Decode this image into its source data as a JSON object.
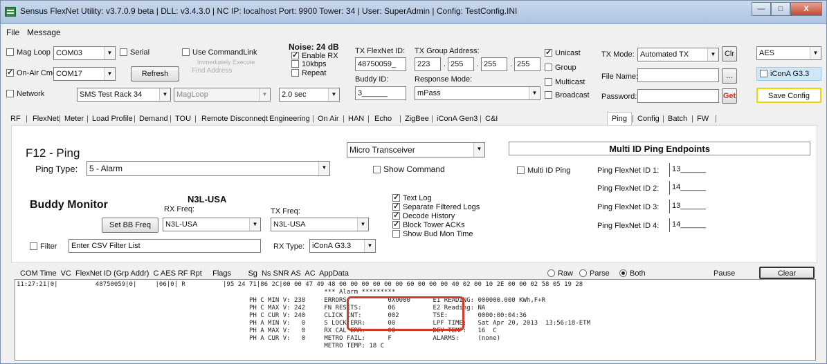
{
  "window": {
    "title": "Sensus FlexNet Utility: v3.7.0.9 beta | DLL: v3.4.3.0 | NC IP: localhost  Port: 9900  Tower: 34 | User: SuperAdmin | Config: TestConfig.INI",
    "min": "—",
    "max": "□",
    "close": "X"
  },
  "menu": {
    "file": "File",
    "message": "Message"
  },
  "conn": {
    "mag_loop_label": "Mag Loop",
    "mag_loop_port": "COM03",
    "serial_label": "Serial",
    "use_commandlink_label": "Use CommandLink",
    "immediately_execute": "Immediately Execute",
    "find_address": "Find Address",
    "onair_label": "On-Air Cmd",
    "onair_port": "COM17",
    "refresh_button": "Refresh",
    "network_label": "Network",
    "network_value": "SMS Test Rack 34",
    "magloop_combo": "MagLoop"
  },
  "noise": {
    "title": "Noise: 24 dB",
    "enable_rx": "Enable RX",
    "kbps": "10kbps",
    "repeat": "Repeat",
    "interval": "2.0 sec"
  },
  "tx": {
    "flexnet_id_label": "TX FlexNet ID:",
    "flexnet_id": "48750059_",
    "group_addr_label": "TX Group Address:",
    "group_1": "223",
    "group_2": "255",
    "group_3": "255",
    "group_4": "255",
    "buddy_id_label": "Buddy ID:",
    "buddy_id": "3______",
    "response_mode_label": "Response Mode:",
    "response_mode": "mPass",
    "unicast": "Unicast",
    "group": "Group",
    "multicast": "Multicast",
    "broadcast": "Broadcast",
    "mode_label": "TX Mode:",
    "mode_value": "Automated TX",
    "clr_button": "Clr",
    "file_name_label": "File Name:",
    "browse_button": "...",
    "password_label": "Password:",
    "get_button": "Get",
    "encryption": "AES",
    "icona_checkbox": "iConA G3.3",
    "save_config_button": "Save Config"
  },
  "tabs": [
    "RF",
    "FlexNet",
    "Meter",
    "Load Profile",
    "Demand",
    "TOU",
    "Remote Disconnect",
    "Engineering",
    "On Air",
    "HAN",
    "Echo",
    "ZigBee",
    "iConA Gen3",
    "C&I",
    "Ping",
    "Config",
    "Batch",
    "FW"
  ],
  "ping": {
    "title": "F12 - Ping",
    "type_label": "Ping Type:",
    "type_value": "5 - Alarm",
    "transceiver": "Micro Transceiver",
    "show_command": "Show Command",
    "multi_title": "Multi ID Ping Endpoints",
    "multi_id_ping": "Multi ID Ping",
    "id1_label": "Ping FlexNet ID 1:",
    "id1": "13______",
    "id2_label": "Ping FlexNet ID 2:",
    "id2": "14______",
    "id3_label": "Ping FlexNet ID 3:",
    "id3": "13______",
    "id4_label": "Ping FlexNet ID 4:",
    "id4": "14______"
  },
  "buddy": {
    "title": "Buddy Monitor",
    "region": "N3L-USA",
    "rx_freq_label": "RX Freq:",
    "rx_freq": "N3L-USA",
    "tx_freq_label": "TX Freq:",
    "tx_freq": "N3L-USA",
    "set_bb_freq": "Set BB Freq",
    "filter_label": "Filter",
    "filter_placeholder": "Enter CSV Filter List",
    "rx_type_label": "RX Type:",
    "rx_type": "iConA G3.3",
    "text_log": "Text Log",
    "separate_logs": "Separate Filtered Logs",
    "decode_history": "Decode History",
    "block_acks": "Block Tower ACKs",
    "show_bud_time": "Show Bud Mon Time"
  },
  "log": {
    "header": "COM Time  VC  FlexNet ID (Grp Addr)  C AES RF Rpt     Flags        Sg  Ns SNR AS  AC  AppData",
    "raw": "Raw",
    "parse": "Parse",
    "both": "Both",
    "pause": "Pause",
    "clear_button": "Clear",
    "lines": [
      "11:27:21|0|          48750059|0|     |06|0| R          |95 24 71|86 2C|00 00 47 49 48 00 00 00 00 00 00 60 00 00 00 40 02 00 10 2E 00 00 02 58 05 19 28",
      "                                                                                  *** Alarm *********",
      "                                                              PH C MIN V: 238     ERRORS:          0X0000      E1 READING: 000000.000 KWh,F+R",
      "                                                              PH C MAX V: 242     FN RESETS:       06          E2 Reading: NA",
      "                                                              PH C CUR V: 240     CLICK CNT:       002         TSE:        0000:00:04:36",
      "                                                              PH A MIN V:   0     S LOCK ERR:      00          LPF TIME:   Sat Apr 20, 2013  13:56:18-ETM",
      "                                                              PH A MAX V:   0     RX CAL ERR:      00          DEV TEMP:   16  C",
      "                                                              PH A CUR V:   0     METRO FAIL:      F           ALARMS:     (none)",
      "                                                                                  METRO TEMP: 18 C"
    ]
  }
}
